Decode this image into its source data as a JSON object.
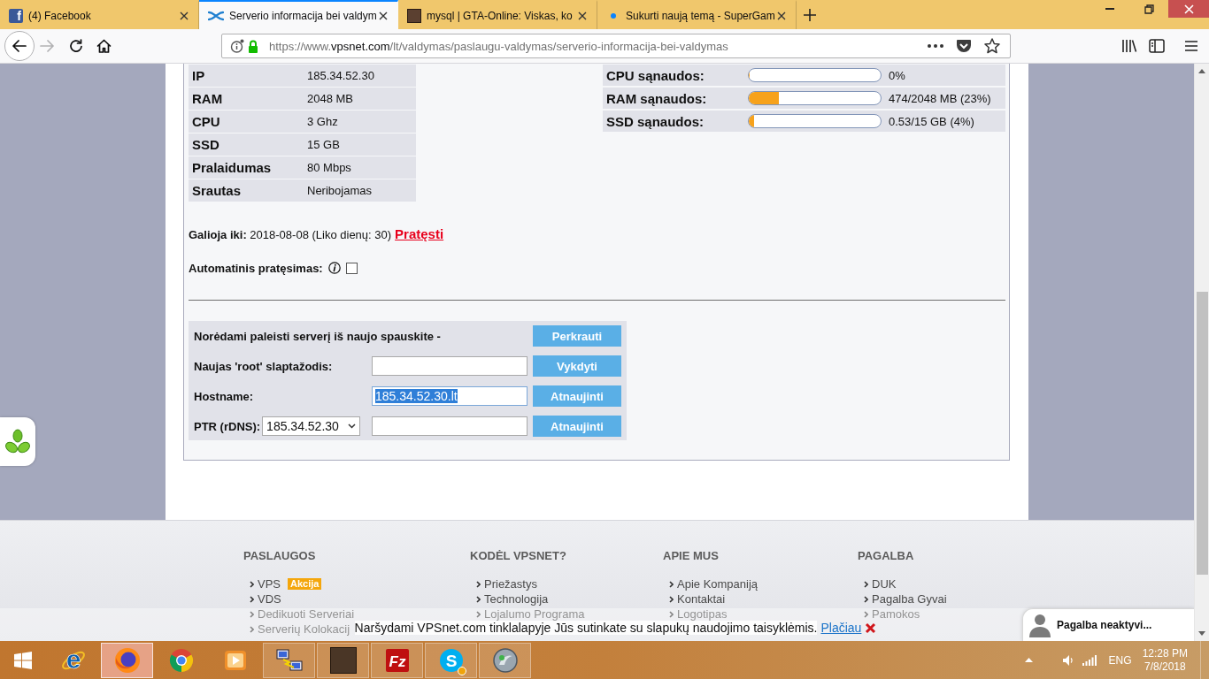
{
  "browser": {
    "tabs": [
      {
        "title": "(4) Facebook",
        "kind": "letter",
        "favicon_text": "f",
        "selected": false
      },
      {
        "title": "Serverio informacija bei valdym",
        "kind": "logo",
        "selected": true
      },
      {
        "title": "mysql | GTA-Online: Viskas, ko",
        "kind": "photo",
        "selected": false
      },
      {
        "title": "Sukurti naują temą - SuperGam",
        "kind": "dot",
        "selected": false
      }
    ],
    "nav_buttons": [
      {
        "kind": "back",
        "disabled": false
      },
      {
        "kind": "forward",
        "disabled": true
      },
      {
        "kind": "reload",
        "disabled": false
      },
      {
        "kind": "home",
        "disabled": false
      }
    ],
    "url": {
      "scheme": "https://www.",
      "domain": "vpsnet.com",
      "path": "/lt/valdymas/paslaugu-valdymas/serverio-informacija-bei-valdymas"
    }
  },
  "specs": [
    {
      "label": "IP",
      "value": "185.34.52.30"
    },
    {
      "label": "RAM",
      "value": "2048 MB"
    },
    {
      "label": "CPU",
      "value": "3 Ghz"
    },
    {
      "label": "SSD",
      "value": "15 GB"
    },
    {
      "label": "Pralaidumas",
      "value": "80 Mbps"
    },
    {
      "label": "Srautas",
      "value": "Neribojamas"
    }
  ],
  "usage": [
    {
      "label": "CPU sąnaudos:",
      "level": 0,
      "reading": "0%"
    },
    {
      "label": "RAM sąnaudos:",
      "level": 0.23,
      "reading": "474/2048 MB (23%)"
    },
    {
      "label": "SSD sąnaudos:",
      "level": 0.04,
      "reading": "0.53/15 GB (4%)"
    }
  ],
  "validity": {
    "text": "**Galioja iki:** 2018-08-08 (Liko dienų: 30)",
    "link": "Pratęsti"
  },
  "auto_renew": {
    "label": "Automatinis pratęsimas:",
    "checked": false
  },
  "actions": [
    {
      "kind": "button",
      "label": "Norėdami paleisti serverį iš naujo spauskite -",
      "button": "Perkrauti"
    },
    {
      "kind": "input",
      "label": "Naujas 'root' slaptažodis:",
      "button": "Vykdyti"
    },
    {
      "kind": "input",
      "label": "Hostname:",
      "value": "185.34.52.30.lt",
      "value_selected": true,
      "button": "Atnaujinti"
    },
    {
      "kind": "select",
      "label": "PTR (rDNS):",
      "select_value": "185.34.52.30",
      "button": "Atnaujinti"
    }
  ],
  "footer": {
    "columns": [
      {
        "heading": "PASLAUGOS",
        "links": [
          {
            "text": "VPS",
            "badge": "Akcija"
          },
          {
            "text": "VDS"
          },
          {
            "text": "Dedikuoti Serveriai"
          },
          {
            "text": "Serverių Kolokacij"
          }
        ]
      },
      {
        "heading": "KODĖL VPSNET?",
        "links": [
          {
            "text": "Priežastys"
          },
          {
            "text": "Technologija"
          },
          {
            "text": "Lojalumo Programa"
          }
        ]
      },
      {
        "heading": "APIE MUS",
        "links": [
          {
            "text": "Apie Kompaniją"
          },
          {
            "text": "Kontaktai"
          },
          {
            "text": "Logotipas"
          }
        ]
      },
      {
        "heading": "PAGALBA",
        "links": [
          {
            "text": "DUK"
          },
          {
            "text": "Pagalba Gyvai"
          },
          {
            "text": "Pamokos"
          }
        ]
      }
    ]
  },
  "cookie_bar": {
    "text": "Naršydami VPSnet.com tinklalapyje Jūs sutinkate su slapukų naudojimo taisyklėmis.",
    "link": "Plačiau"
  },
  "chat": {
    "label": "Pagalba neaktyvi..."
  },
  "taskbar": {
    "apps": [
      {
        "kind": "ie",
        "glyph": "e",
        "running": false,
        "selected": false
      },
      {
        "kind": "firefox",
        "running": true,
        "selected": true
      },
      {
        "kind": "chrome",
        "running": false,
        "selected": false
      },
      {
        "kind": "player",
        "running": false,
        "selected": false
      },
      {
        "kind": "network",
        "running": true,
        "selected": false
      },
      {
        "kind": "photo",
        "running": true,
        "selected": false
      },
      {
        "kind": "filezilla",
        "glyph": "Fz",
        "running": true,
        "selected": false
      },
      {
        "kind": "skype",
        "glyph": "S",
        "badge": true,
        "running": true,
        "selected": false
      },
      {
        "kind": "app",
        "running": true,
        "selected": false
      }
    ],
    "tray": {
      "language": "ENG",
      "time": "12:28 PM",
      "date": "7/8/2018"
    }
  }
}
